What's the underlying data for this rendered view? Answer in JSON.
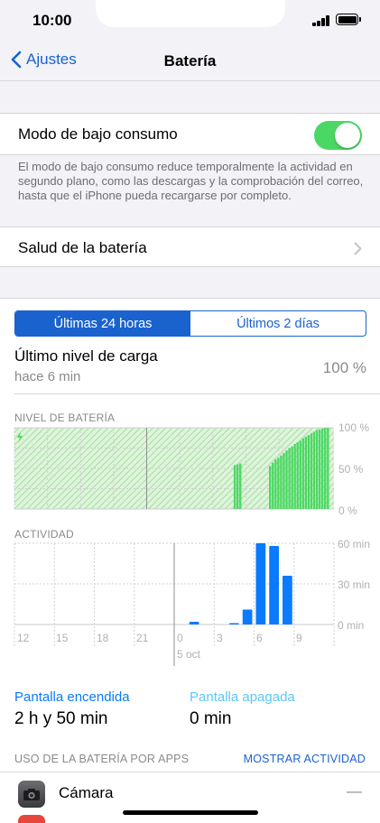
{
  "status": {
    "time": "10:00"
  },
  "nav": {
    "back_label": "Ajustes",
    "title": "Batería"
  },
  "low_power": {
    "label": "Modo de bajo consumo",
    "enabled": true,
    "footnote": "El modo de bajo consumo reduce temporalmente la actividad en segundo plano, como las descargas y la comprobación del correo, hasta que el iPhone pueda recargarse por completo."
  },
  "battery_health": {
    "label": "Salud de la batería"
  },
  "range_tabs": [
    {
      "label": "Últimas 24 horas",
      "selected": true
    },
    {
      "label": "Últimos 2 días",
      "selected": false
    }
  ],
  "last_charge": {
    "title": "Último nivel de carga",
    "subtitle": "hace 6 min",
    "value": "100 %"
  },
  "colors": {
    "accent": "#1a62ce",
    "toggle_on": "#4bd763",
    "battery_bar": "#4cd964",
    "activity_bar": "#0a7aff",
    "screen_off": "#5ac8fa"
  },
  "chart_data": [
    {
      "type": "bar",
      "title": "NIVEL DE BATERÍA",
      "y_ticks": [
        "100 %",
        "50 %",
        "0 %"
      ],
      "ylim": [
        0,
        100
      ],
      "unit": "%",
      "x_range_hours": [
        0,
        24
      ],
      "series": [
        {
          "values": [
            [
              20.0,
              54
            ],
            [
              20.25,
              55
            ],
            [
              20.5,
              56
            ],
            [
              23.2,
              53
            ],
            [
              23.45,
              57
            ],
            [
              23.7,
              61
            ],
            [
              23.95,
              63
            ],
            [
              24.2,
              66
            ],
            [
              24.45,
              69
            ],
            [
              24.7,
              72
            ],
            [
              24.95,
              75
            ],
            [
              25.2,
              77
            ],
            [
              25.45,
              80
            ],
            [
              25.7,
              82
            ],
            [
              25.95,
              84
            ],
            [
              26.2,
              87
            ],
            [
              26.45,
              89
            ],
            [
              26.7,
              91
            ],
            [
              26.95,
              93
            ],
            [
              27.2,
              95
            ],
            [
              27.45,
              97
            ],
            [
              27.7,
              98
            ],
            [
              27.95,
              99
            ],
            [
              28.2,
              100
            ],
            [
              28.45,
              100
            ]
          ]
        }
      ],
      "charging_icon": "lightning-bolt-icon"
    },
    {
      "type": "bar",
      "title": "ACTIVIDAD",
      "y_ticks": [
        "60 min",
        "30 min",
        "0 min"
      ],
      "ylim": [
        0,
        60
      ],
      "x_tick_labels": [
        "12",
        "15",
        "18",
        "21",
        "0",
        "3",
        "6",
        "9"
      ],
      "date_label": "5 oct",
      "series": [
        {
          "name": "Pantalla encendida",
          "values": [
            {
              "hour_start": "1",
              "minutes": 2
            },
            {
              "hour_start": "4",
              "minutes": 1
            },
            {
              "hour_start": "5",
              "minutes": 11
            },
            {
              "hour_start": "6",
              "minutes": 60
            },
            {
              "hour_start": "7",
              "minutes": 58
            },
            {
              "hour_start": "8",
              "minutes": 36
            }
          ]
        },
        {
          "name": "Pantalla apagada",
          "values": []
        }
      ]
    }
  ],
  "legend": {
    "screen_on_label": "Pantalla encendida",
    "screen_on_value": "2 h y 50 min",
    "screen_off_label": "Pantalla apagada",
    "screen_off_value": "0 min"
  },
  "usage": {
    "header": "USO DE LA BATERÍA POR APPS",
    "toggle_label": "MOSTRAR ACTIVIDAD",
    "apps": [
      {
        "name": "Cámara",
        "value": "—",
        "icon": "camera-icon"
      }
    ]
  }
}
